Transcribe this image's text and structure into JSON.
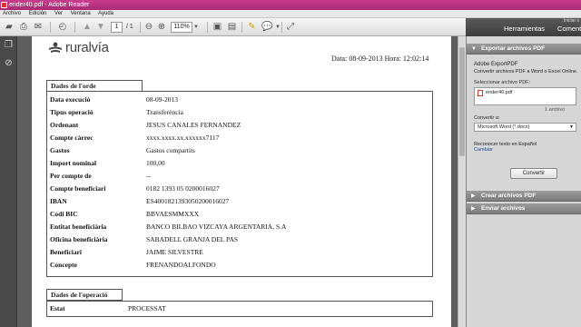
{
  "window": {
    "title": "ender40.pdf - Adobe Reader"
  },
  "menu": [
    "Archivo",
    "Edición",
    "Ver",
    "Ventana",
    "Ayuda"
  ],
  "toolbar": {
    "page_current": "1",
    "page_total": "/ 1",
    "zoom": "110%"
  },
  "right_tabs": {
    "herramientas": "Herramientas",
    "comentario": "Comentario",
    "iniciar_sesion": "Iniciar s"
  },
  "document": {
    "logo_text": "ruralvía",
    "date_line": "Data: 08-09-2013  Hora: 12:02:14",
    "section1_title": "Dades de l'orde",
    "fields": [
      {
        "label": "Data execució",
        "value": "08-09-2013"
      },
      {
        "label": "Tipus operació",
        "value": "Transferència"
      },
      {
        "label": "Ordenant",
        "value": "JESUS CANALES FERNANDEZ"
      },
      {
        "label": "Compte càrrec",
        "value": "xxxx.xxxx.xx.xxxxxx7117"
      },
      {
        "label": "Gastos",
        "value": "Gastos compartits"
      },
      {
        "label": "Import nominal",
        "value": "100,00"
      },
      {
        "label": "Per compte de",
        "value": "--"
      },
      {
        "label": "Compte beneficiari",
        "value": "0182 1393 05 0200016027"
      },
      {
        "label": "IBAN",
        "value": "ES4001821393050200016027"
      },
      {
        "label": "Codi BIC",
        "value": "BBVAESMMXXX"
      },
      {
        "label": "Entitat beneficiària",
        "value": "BANCO BILBAO VIZCAYA ARGENTARIA, S.A"
      },
      {
        "label": "Oficina beneficiària",
        "value": "SABADELL GRANJA DEL PAS"
      },
      {
        "label": "Beneficiari",
        "value": "JAIME SILVESTRE"
      },
      {
        "label": "Concepte",
        "value": "FRENANDOALFONDO"
      }
    ],
    "section2_title": "Dades de l'operació",
    "estat_label": "Estat",
    "estat_value": "PROCESSAT"
  },
  "panel": {
    "export_header": "Exportar archivos PDF",
    "export_title": "Adobe ExportPDF",
    "export_desc": "Convertir archivos PDF a Word o Excel Online.",
    "select_label": "Seleccionar archivo PDF:",
    "file_name": "ender40.pdf",
    "file_count": "1 archivo",
    "convert_label": "Convertir a:",
    "convert_value": "Microsoft Word (*.docx)",
    "recognize_text": "Reconocer texto en Español",
    "change_link": "Cambiar",
    "convert_button": "Convertir",
    "create_header": "Crear archivos PDF",
    "send_header": "Enviar archivos"
  }
}
